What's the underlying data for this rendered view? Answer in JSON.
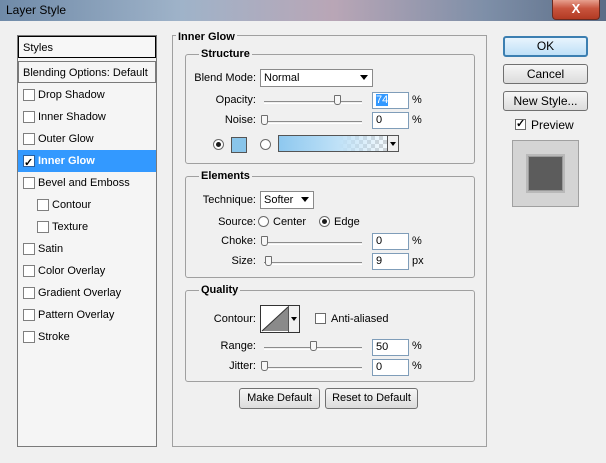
{
  "window": {
    "title": "Layer Style",
    "close_label": "X"
  },
  "styles_panel": {
    "header": "Styles",
    "blending": "Blending Options: Default",
    "items": [
      {
        "label": "Drop Shadow",
        "checked": false,
        "selected": false,
        "indent": false
      },
      {
        "label": "Inner Shadow",
        "checked": false,
        "selected": false,
        "indent": false
      },
      {
        "label": "Outer Glow",
        "checked": false,
        "selected": false,
        "indent": false
      },
      {
        "label": "Inner Glow",
        "checked": true,
        "selected": true,
        "indent": false
      },
      {
        "label": "Bevel and Emboss",
        "checked": false,
        "selected": false,
        "indent": false
      },
      {
        "label": "Contour",
        "checked": false,
        "selected": false,
        "indent": true
      },
      {
        "label": "Texture",
        "checked": false,
        "selected": false,
        "indent": true
      },
      {
        "label": "Satin",
        "checked": false,
        "selected": false,
        "indent": false
      },
      {
        "label": "Color Overlay",
        "checked": false,
        "selected": false,
        "indent": false
      },
      {
        "label": "Gradient Overlay",
        "checked": false,
        "selected": false,
        "indent": false
      },
      {
        "label": "Pattern Overlay",
        "checked": false,
        "selected": false,
        "indent": false
      },
      {
        "label": "Stroke",
        "checked": false,
        "selected": false,
        "indent": false
      }
    ]
  },
  "main": {
    "title": "Inner Glow",
    "structure": {
      "title": "Structure",
      "blend_mode_label": "Blend Mode:",
      "blend_mode_value": "Normal",
      "opacity_label": "Opacity:",
      "opacity_value": "74",
      "opacity_unit": "%",
      "noise_label": "Noise:",
      "noise_value": "0",
      "noise_unit": "%",
      "glow_color": "#89c5ea"
    },
    "elements": {
      "title": "Elements",
      "technique_label": "Technique:",
      "technique_value": "Softer",
      "source_label": "Source:",
      "source_center": "Center",
      "source_edge": "Edge",
      "choke_label": "Choke:",
      "choke_value": "0",
      "choke_unit": "%",
      "size_label": "Size:",
      "size_value": "9",
      "size_unit": "px"
    },
    "quality": {
      "title": "Quality",
      "contour_label": "Contour:",
      "antialiased_label": "Anti-aliased",
      "range_label": "Range:",
      "range_value": "50",
      "range_unit": "%",
      "jitter_label": "Jitter:",
      "jitter_value": "0",
      "jitter_unit": "%"
    },
    "make_default": "Make Default",
    "reset_default": "Reset to Default"
  },
  "actions": {
    "ok": "OK",
    "cancel": "Cancel",
    "new_style": "New Style...",
    "preview_label": "Preview"
  }
}
